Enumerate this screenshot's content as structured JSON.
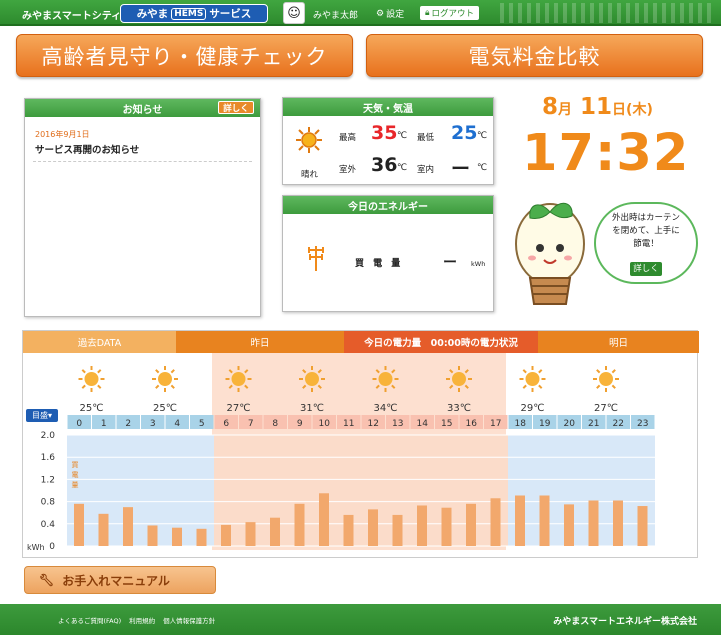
{
  "header": {
    "city": "みやまスマートシティ",
    "service_prefix": "みやま",
    "service_hems": "HEMS",
    "service_suffix": "サービス",
    "user_name": "みやま太郎",
    "settings": "設定",
    "logout": "ログアウト"
  },
  "nav": {
    "watch_label": "高齢者見守り・健康チェック",
    "compare_label": "電気料金比較"
  },
  "news": {
    "title": "お知らせ",
    "more": "詳しく",
    "date": "2016年9月1日",
    "headline": "サービス再開のお知らせ"
  },
  "weather": {
    "title": "天気・気温",
    "condition": "晴れ",
    "high_label": "最高",
    "high_value": "35",
    "low_label": "最低",
    "low_value": "25",
    "out_label": "室外",
    "out_value": "36",
    "in_label": "室内",
    "in_value": "ー",
    "unit": "℃",
    "colors": {
      "high": "#e8262a",
      "low": "#1e6fd0"
    }
  },
  "energy": {
    "title": "今日のエネルギー",
    "label": "買 電 量",
    "value": "ー",
    "unit": "kWh"
  },
  "clock": {
    "month": "8",
    "month_unit": "月",
    "day": "11",
    "day_unit": "日",
    "weekday": "(木)",
    "time": "17:32"
  },
  "tip": {
    "text_line1": "外出時はカーテン",
    "text_line2": "を閉めて、上手に",
    "text_line3": "節電！",
    "more": "詳しく"
  },
  "power_tabs": {
    "past": "過去DATA",
    "yesterday": "昨日",
    "today": "今日の電力量　00:00時の電力状況",
    "tomorrow": "明日"
  },
  "scope": "目盛",
  "manual": "お手入れマニュアル",
  "footer": {
    "faq": "よくあるご質問(FAQ)",
    "terms": "利用規約",
    "privacy": "個人情報保護方針",
    "company": "みやまスマートエネルギー株式会社"
  },
  "chart_data": {
    "type": "bar",
    "ylabel": "kWh",
    "series_label": "買電量",
    "ylim": [
      0,
      2.0
    ],
    "yticks": [
      "2.0",
      "1.6",
      "1.2",
      "0.8",
      "0.4",
      "0"
    ],
    "categories": [
      "0",
      "1",
      "2",
      "3",
      "4",
      "5",
      "6",
      "7",
      "8",
      "9",
      "10",
      "11",
      "12",
      "13",
      "14",
      "15",
      "16",
      "17",
      "18",
      "19",
      "20",
      "21",
      "22",
      "23"
    ],
    "values": [
      0.76,
      0.58,
      0.7,
      0.37,
      0.33,
      0.31,
      0.38,
      0.43,
      0.51,
      0.76,
      0.95,
      0.56,
      0.66,
      0.56,
      0.73,
      0.69,
      0.76,
      0.86,
      0.91,
      0.91,
      0.75,
      0.82,
      0.82,
      0.72
    ],
    "weather_temps": [
      "25℃",
      "25℃",
      "27℃",
      "31℃",
      "34℃",
      "33℃",
      "29℃",
      "27℃"
    ],
    "bar_color": "#f2a86c",
    "highlight_hours": [
      6,
      17
    ]
  }
}
